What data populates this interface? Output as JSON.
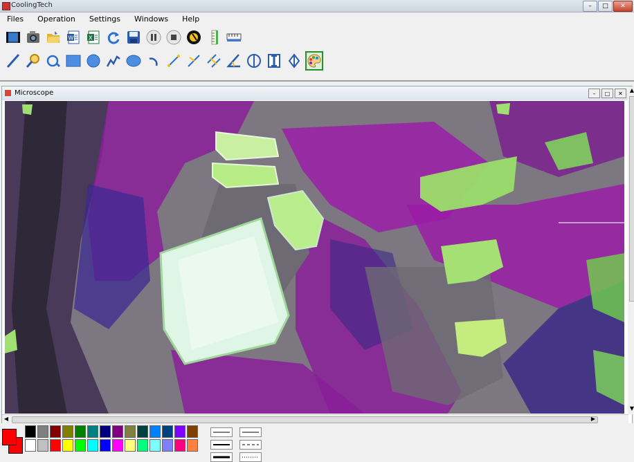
{
  "window": {
    "title": "CoolingTech",
    "controls": [
      "minimize",
      "maximize",
      "close"
    ]
  },
  "menu": {
    "items": [
      "Files",
      "Operation",
      "Settings",
      "Windows",
      "Help"
    ]
  },
  "toolbar1": {
    "buttons": [
      "video-icon",
      "camera-icon",
      "open-folder-icon",
      "export-word-icon",
      "export-excel-icon",
      "refresh-icon",
      "save-icon",
      "pause-icon",
      "stop-icon",
      "calibrate-icon",
      "vertical-ruler-icon",
      "horizontal-ruler-icon"
    ]
  },
  "toolbar2": {
    "buttons": [
      "line-tool-icon",
      "zoom-icon",
      "rotate-icon",
      "rectangle-tool-icon",
      "circle-tool-icon",
      "polyline-tool-icon",
      "ellipse-tool-icon",
      "arc-tool-icon",
      "point-distance-icon",
      "point-line-distance-icon",
      "parallel-distance-icon",
      "angle-tool-icon",
      "circle-diameter-icon",
      "height-measure-icon",
      "vertical-measure-icon",
      "color-palette-icon"
    ],
    "selected": "color-palette-icon"
  },
  "child_window": {
    "title": "Microscope"
  },
  "palette": {
    "current_fg": "#ff0000",
    "current_bg": "#ff0000",
    "row1": [
      "#000000",
      "#808080",
      "#800000",
      "#808000",
      "#008000",
      "#008080",
      "#000080",
      "#800080",
      "#808040",
      "#004040",
      "#0080ff",
      "#004080",
      "#8000ff",
      "#804000"
    ],
    "row2": [
      "#ffffff",
      "#c0c0c0",
      "#ff0000",
      "#ffff00",
      "#00ff00",
      "#00ffff",
      "#0000ff",
      "#ff00ff",
      "#ffff80",
      "#00ff80",
      "#80ffff",
      "#8080ff",
      "#ff0080",
      "#ff8040"
    ],
    "line_styles": [
      "thin-line",
      "solid-line",
      "medium-line",
      "dash-line",
      "thick-line",
      "dot-line"
    ]
  }
}
